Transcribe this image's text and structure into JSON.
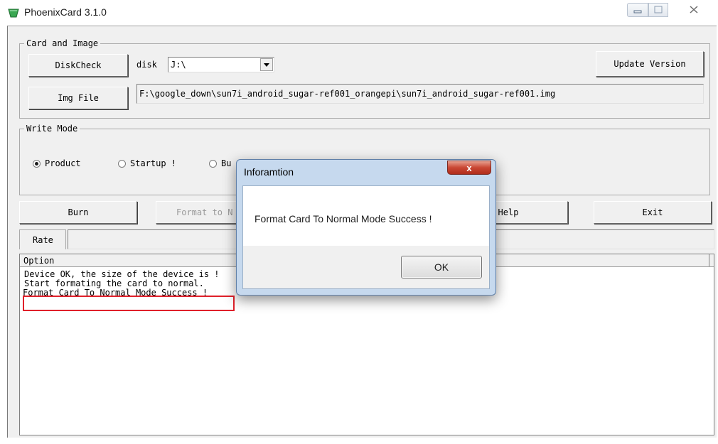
{
  "window": {
    "title": "PhoenixCard 3.1.0"
  },
  "card_image": {
    "group_label": "Card and Image",
    "diskcheck_label": "DiskCheck",
    "disk_label": "disk",
    "disk_value": "J:\\",
    "update_label": "Update Version",
    "imgfile_label": "Img File",
    "img_path": "F:\\google_down\\sun7i_android_sugar-ref001_orangepi\\sun7i_android_sugar-ref001.img"
  },
  "write_mode": {
    "group_label": "Write Mode",
    "options": [
      {
        "label": "Product",
        "checked": true
      },
      {
        "label": "Startup !",
        "checked": false
      },
      {
        "label": "Bu",
        "checked": false
      }
    ]
  },
  "actions": {
    "burn": "Burn",
    "format": "Format to N",
    "help": "Help",
    "exit": "Exit"
  },
  "rate": {
    "label": "Rate"
  },
  "log": {
    "header": "Option",
    "lines": [
      "Device OK, the size of the device is !",
      "Start formating the card to normal.",
      "Format Card To Normal Mode Success !"
    ]
  },
  "dialog": {
    "title": "Inforamtion",
    "message": "Format Card To Normal Mode Success !",
    "ok_label": "OK",
    "close_glyph": "x"
  },
  "colors": {
    "window_bg": "#f0f0f0",
    "highlight": "#e0202a",
    "dialog_frame": "#c6d9ee",
    "close_button": "#c94633"
  }
}
